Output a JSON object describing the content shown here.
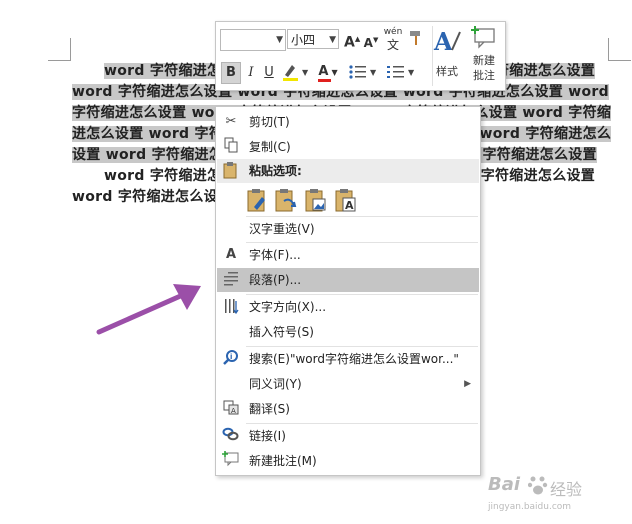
{
  "document": {
    "lines": [
      "word 字符缩进怎么设置 word 字符缩进怎么设置 word 字符缩进怎么设置",
      "word 字符缩进怎么设置 word 字符缩进怎么设置 word 字符缩进怎么设置 word",
      "字符缩进怎么设置 word 字符缩进怎么设置 word 字符缩进怎么设置 word 字符缩",
      "进怎么设置 word 字符缩进怎么设置 word 字符缩进怎么设置 word 字符缩进怎么",
      "设置 word 字符缩进怎么设置 word 字符缩进怎么设置 word 字符缩进怎么设置",
      "word 字符缩进怎么设置 word 字符缩进怎么设置 word 字符缩进怎么设置",
      "word 字符缩进怎么设"
    ]
  },
  "mini_toolbar": {
    "font_name": "",
    "font_size": "小四",
    "bold": "B",
    "italic": "I",
    "underline": "U",
    "font_color": "A",
    "bullets_icon": "bullet-list-icon",
    "numbering_icon": "numbered-list-icon",
    "grow_font": "A",
    "shrink_font": "A",
    "phonetic": "wén",
    "phonetic_char": "文",
    "styles_label": "样式",
    "new_comment_label_1": "新建",
    "new_comment_label_2": "批注"
  },
  "context_menu": {
    "cut": "剪切(T)",
    "copy": "复制(C)",
    "paste_options": "粘贴选项:",
    "reconvert": "汉字重选(V)",
    "font": "字体(F)...",
    "paragraph": "段落(P)...",
    "text_direction": "文字方向(X)...",
    "insert_symbol": "插入符号(S)",
    "search": "搜索(E)\"word字符缩进怎么设置wor...\"",
    "synonyms": "同义词(Y)",
    "translate": "翻译(S)",
    "link": "链接(I)",
    "new_comment": "新建批注(M)"
  },
  "watermark": {
    "brand": "Bai",
    "brand_cn": "经验",
    "url": "jingyan.baidu.com"
  },
  "colors": {
    "highlight": "#c8c8c8",
    "menu_hover": "#c5c5c5",
    "arrow": "#9b4fa8",
    "accent_blue": "#2b64b0"
  }
}
